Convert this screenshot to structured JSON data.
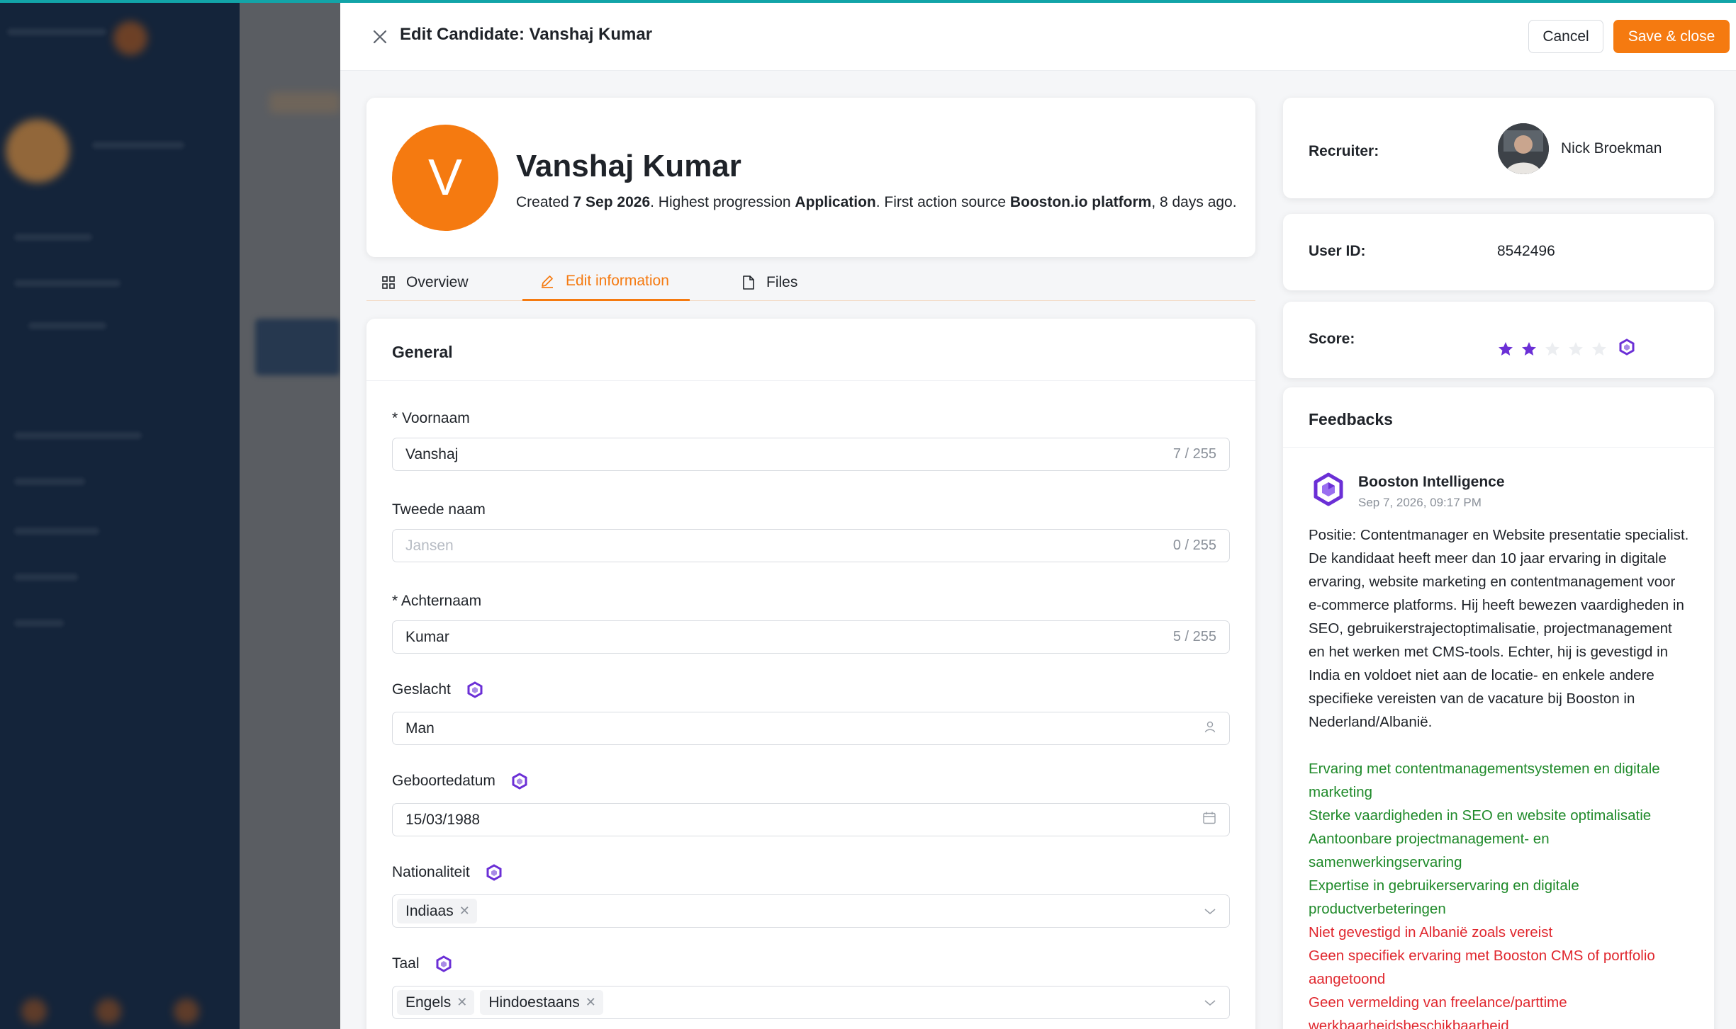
{
  "header": {
    "title": "Edit Candidate: Vanshaj Kumar",
    "cancel_label": "Cancel",
    "save_label": "Save & close"
  },
  "profile": {
    "initial": "V",
    "name": "Vanshaj Kumar",
    "meta": {
      "created_prefix": "Created ",
      "created_date": "7 Sep 2026",
      "progression_prefix": ". Highest progression ",
      "progression": "Application",
      "source_prefix": ". First action source ",
      "source": "Booston.io platform",
      "ago": ", 8 days ago."
    }
  },
  "tabs": [
    {
      "label": "Overview",
      "icon": "grid-icon",
      "active": false
    },
    {
      "label": "Edit information",
      "icon": "pencil-icon",
      "active": true
    },
    {
      "label": "Files",
      "icon": "file-icon",
      "active": false
    }
  ],
  "general": {
    "title": "General",
    "fields": {
      "voornaam": {
        "label": "* Voornaam",
        "value": "Vanshaj",
        "counter": "7 / 255"
      },
      "tweede_naam": {
        "label": "Tweede naam",
        "placeholder": "Jansen",
        "counter": "0 / 255"
      },
      "achternaam": {
        "label": "* Achternaam",
        "value": "Kumar",
        "counter": "5 / 255"
      },
      "geslacht": {
        "label": "Geslacht",
        "value": "Man",
        "icon": "person-icon"
      },
      "geboortedatum": {
        "label": "Geboortedatum",
        "value": "15/03/1988",
        "icon": "calendar-icon"
      },
      "nationaliteit": {
        "label": "Nationaliteit",
        "tags": [
          "Indiaas"
        ]
      },
      "taal": {
        "label": "Taal",
        "tags": [
          "Engels",
          "Hindoestaans"
        ]
      }
    }
  },
  "recruiter": {
    "label": "Recruiter:",
    "name": "Nick Broekman"
  },
  "user_id": {
    "label": "User ID:",
    "value": "8542496"
  },
  "score": {
    "label": "Score:",
    "value": 2,
    "max": 5,
    "filled_color": "#6b2fd6",
    "empty_color": "#eceef1"
  },
  "feedbacks": {
    "title": "Feedbacks",
    "author": "Booston Intelligence",
    "date": "Sep 7, 2026, 09:17 PM",
    "text": "Positie: Contentmanager en Website presentatie specialist. De kandidaat heeft meer dan 10 jaar ervaring in digitale ervaring, website marketing en contentmanagement voor e-commerce platforms. Hij heeft bewezen vaardigheden in SEO, gebruikerstrajectoptimalisatie, projectmanagement en het werken met CMS-tools. Echter, hij is gevestigd in India en voldoet niet aan de locatie- en enkele andere specifieke vereisten van de vacature bij Booston in Nederland/Albanië.",
    "positives": [
      "Ervaring met contentmanagementsystemen en digitale marketing",
      "Sterke vaardigheden in SEO en website optimalisatie",
      "Aantoonbare projectmanagement- en samenwerkingservaring",
      "Expertise in gebruikerservaring en digitale productverbeteringen"
    ],
    "negatives": [
      "Niet gevestigd in Albanië zoals vereist",
      "Geen specifiek ervaring met Booston CMS of portfolio aangetoond",
      "Geen vermelding van freelance/parttime werkbaarheidsbeschikbaarheid"
    ]
  },
  "colors": {
    "accent": "#f57a10",
    "ai_purple": "#6b2fd6",
    "positive": "#1f8a2a",
    "negative": "#e0282f"
  }
}
